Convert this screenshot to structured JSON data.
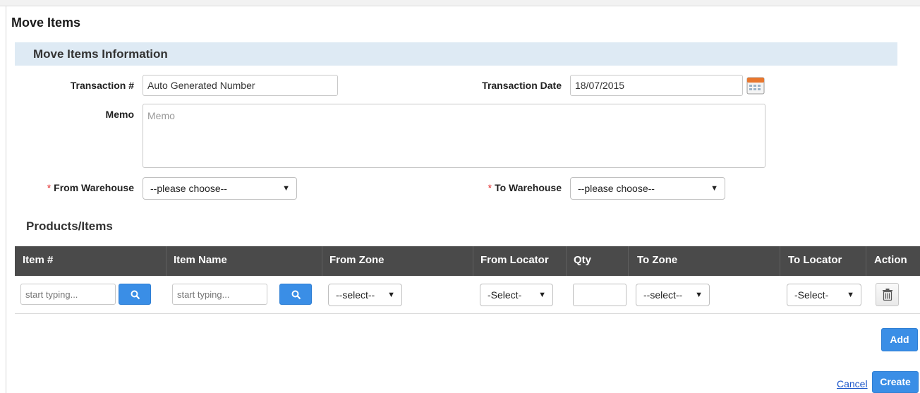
{
  "page": {
    "title": "Move Items"
  },
  "section": {
    "title": "Move Items Information"
  },
  "form": {
    "transaction_label": "Transaction #",
    "transaction_value": "Auto Generated Number",
    "date_label": "Transaction Date",
    "date_value": "18/07/2015",
    "memo_label": "Memo",
    "memo_placeholder": "Memo",
    "required_marker": "*",
    "from_warehouse_label": "From Warehouse",
    "from_warehouse_value": "--please choose--",
    "to_warehouse_label": "To Warehouse",
    "to_warehouse_value": "--please choose--"
  },
  "products": {
    "title": "Products/Items",
    "columns": [
      "Item #",
      "Item Name",
      "From Zone",
      "From Locator",
      "Qty",
      "To Zone",
      "To Locator",
      "Action"
    ],
    "row": {
      "item_placeholder": "start typing...",
      "item_name_placeholder": "start typing...",
      "from_zone": "--select--",
      "from_locator": "-Select-",
      "qty": "",
      "to_zone": "--select--",
      "to_locator": "-Select-"
    }
  },
  "actions": {
    "add": "Add",
    "cancel": "Cancel",
    "create": "Create"
  },
  "icons": {
    "search": "search-icon",
    "calendar": "calendar-icon",
    "trash": "trash-icon",
    "dropdown": "dropdown-arrow-icon"
  },
  "colors": {
    "accent": "#3a8ee6",
    "header_bg": "#4a4a4a",
    "section_bg": "#deeaf4",
    "required": "#e02020",
    "link": "#1a55c9"
  }
}
